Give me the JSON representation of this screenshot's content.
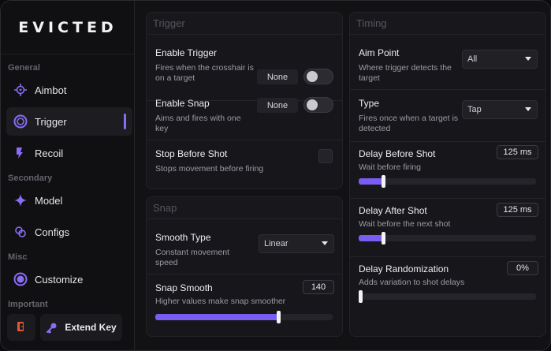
{
  "app": {
    "title": "EVICTED",
    "accent": "#8b6cf6"
  },
  "sidebar": {
    "sections": [
      {
        "label": "General"
      },
      {
        "label": "Secondary"
      },
      {
        "label": "Misc"
      },
      {
        "label": "Important"
      }
    ],
    "items": [
      {
        "label": "Aimbot",
        "icon": "crosshair-icon"
      },
      {
        "label": "Trigger",
        "icon": "target-ring-icon",
        "active": true
      },
      {
        "label": "Recoil",
        "icon": "recoil-icon"
      },
      {
        "label": "Model",
        "icon": "sparkle-icon"
      },
      {
        "label": "Configs",
        "icon": "link-icon"
      },
      {
        "label": "Customize",
        "icon": "palette-icon"
      }
    ],
    "bottom": {
      "exit_icon": "exit-door-icon",
      "extend_label": "Extend Key",
      "extend_icon": "key-icon"
    }
  },
  "trigger": {
    "header": "Trigger",
    "enable_trigger": {
      "title": "Enable Trigger",
      "desc": "Fires when the crosshair is on a target",
      "key": "None",
      "on": false
    },
    "enable_snap": {
      "title": "Enable Snap",
      "desc": "Aims and fires with one key",
      "key": "None",
      "on": false
    },
    "stop_before_shot": {
      "title": "Stop Before Shot",
      "desc": "Stops movement before firing",
      "checked": false
    }
  },
  "snap": {
    "header": "Snap",
    "smooth_type": {
      "title": "Smooth Type",
      "desc": "Constant movement speed",
      "value": "Linear"
    },
    "snap_smooth": {
      "title": "Snap Smooth",
      "desc": "Higher values make snap smoother",
      "value": "140",
      "fraction": 0.7
    }
  },
  "timing": {
    "header": "Timing",
    "aim_point": {
      "title": "Aim Point",
      "desc": "Where trigger detects the target",
      "value": "All"
    },
    "type": {
      "title": "Type",
      "desc": "Fires once when a target is detected",
      "value": "Tap"
    },
    "delay_before": {
      "title": "Delay Before Shot",
      "desc": "Wait before firing",
      "value": "125 ms",
      "fraction": 0.13
    },
    "delay_after": {
      "title": "Delay After Shot",
      "desc": "Wait before the next shot",
      "value": "125 ms",
      "fraction": 0.13
    },
    "delay_random": {
      "title": "Delay Randomization",
      "desc": "Adds variation to shot delays",
      "value": "0%",
      "fraction": 0.0
    }
  }
}
